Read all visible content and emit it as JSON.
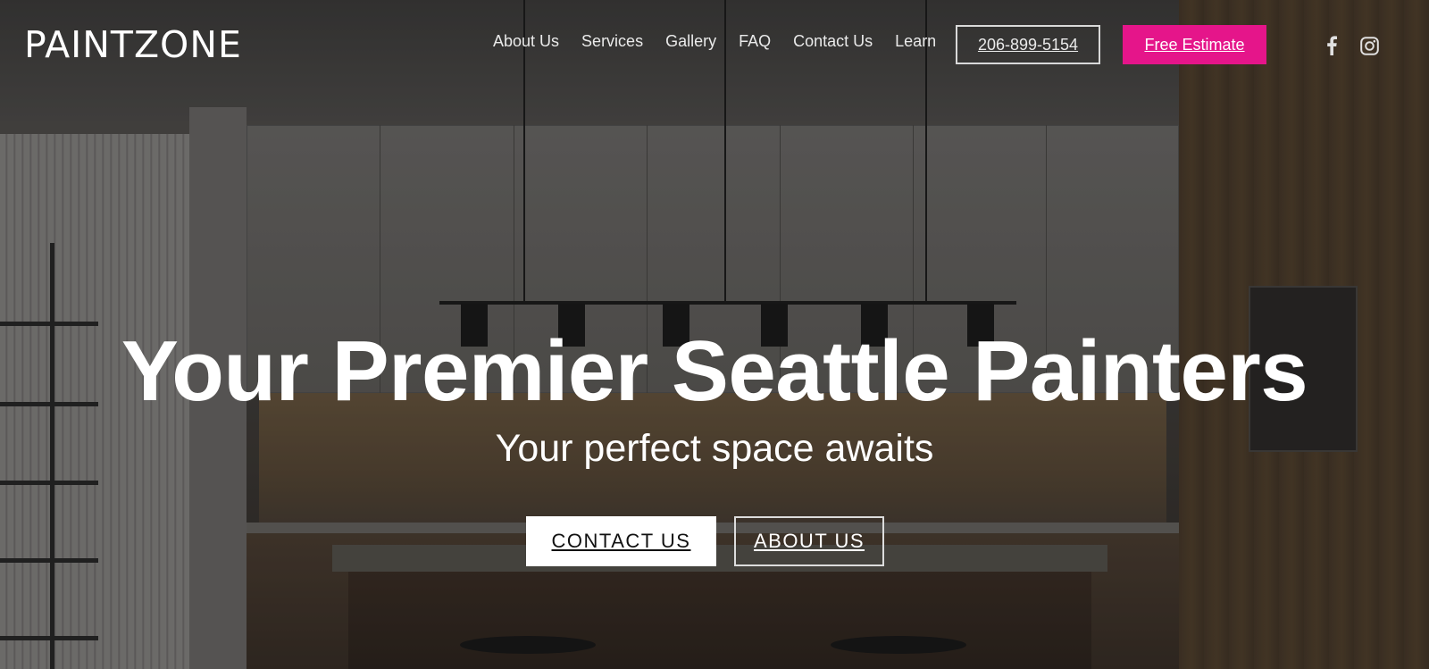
{
  "brand": {
    "logo_text": "PAINTZONE"
  },
  "nav": {
    "items": [
      {
        "label": "About Us"
      },
      {
        "label": "Services"
      },
      {
        "label": "Gallery"
      },
      {
        "label": "FAQ"
      },
      {
        "label": "Contact Us"
      },
      {
        "label": "Learn"
      }
    ]
  },
  "header_actions": {
    "phone_label": "206-899-5154",
    "estimate_label": "Free Estimate",
    "social": [
      {
        "icon": "facebook-icon"
      },
      {
        "icon": "instagram-icon"
      }
    ]
  },
  "hero": {
    "title": "Your Premier Seattle Painters",
    "subtitle": "Your perfect space awaits",
    "primary_cta": "CONTACT US",
    "secondary_cta": "ABOUT US"
  },
  "colors": {
    "accent": "#e5158a",
    "text": "#ffffff"
  }
}
